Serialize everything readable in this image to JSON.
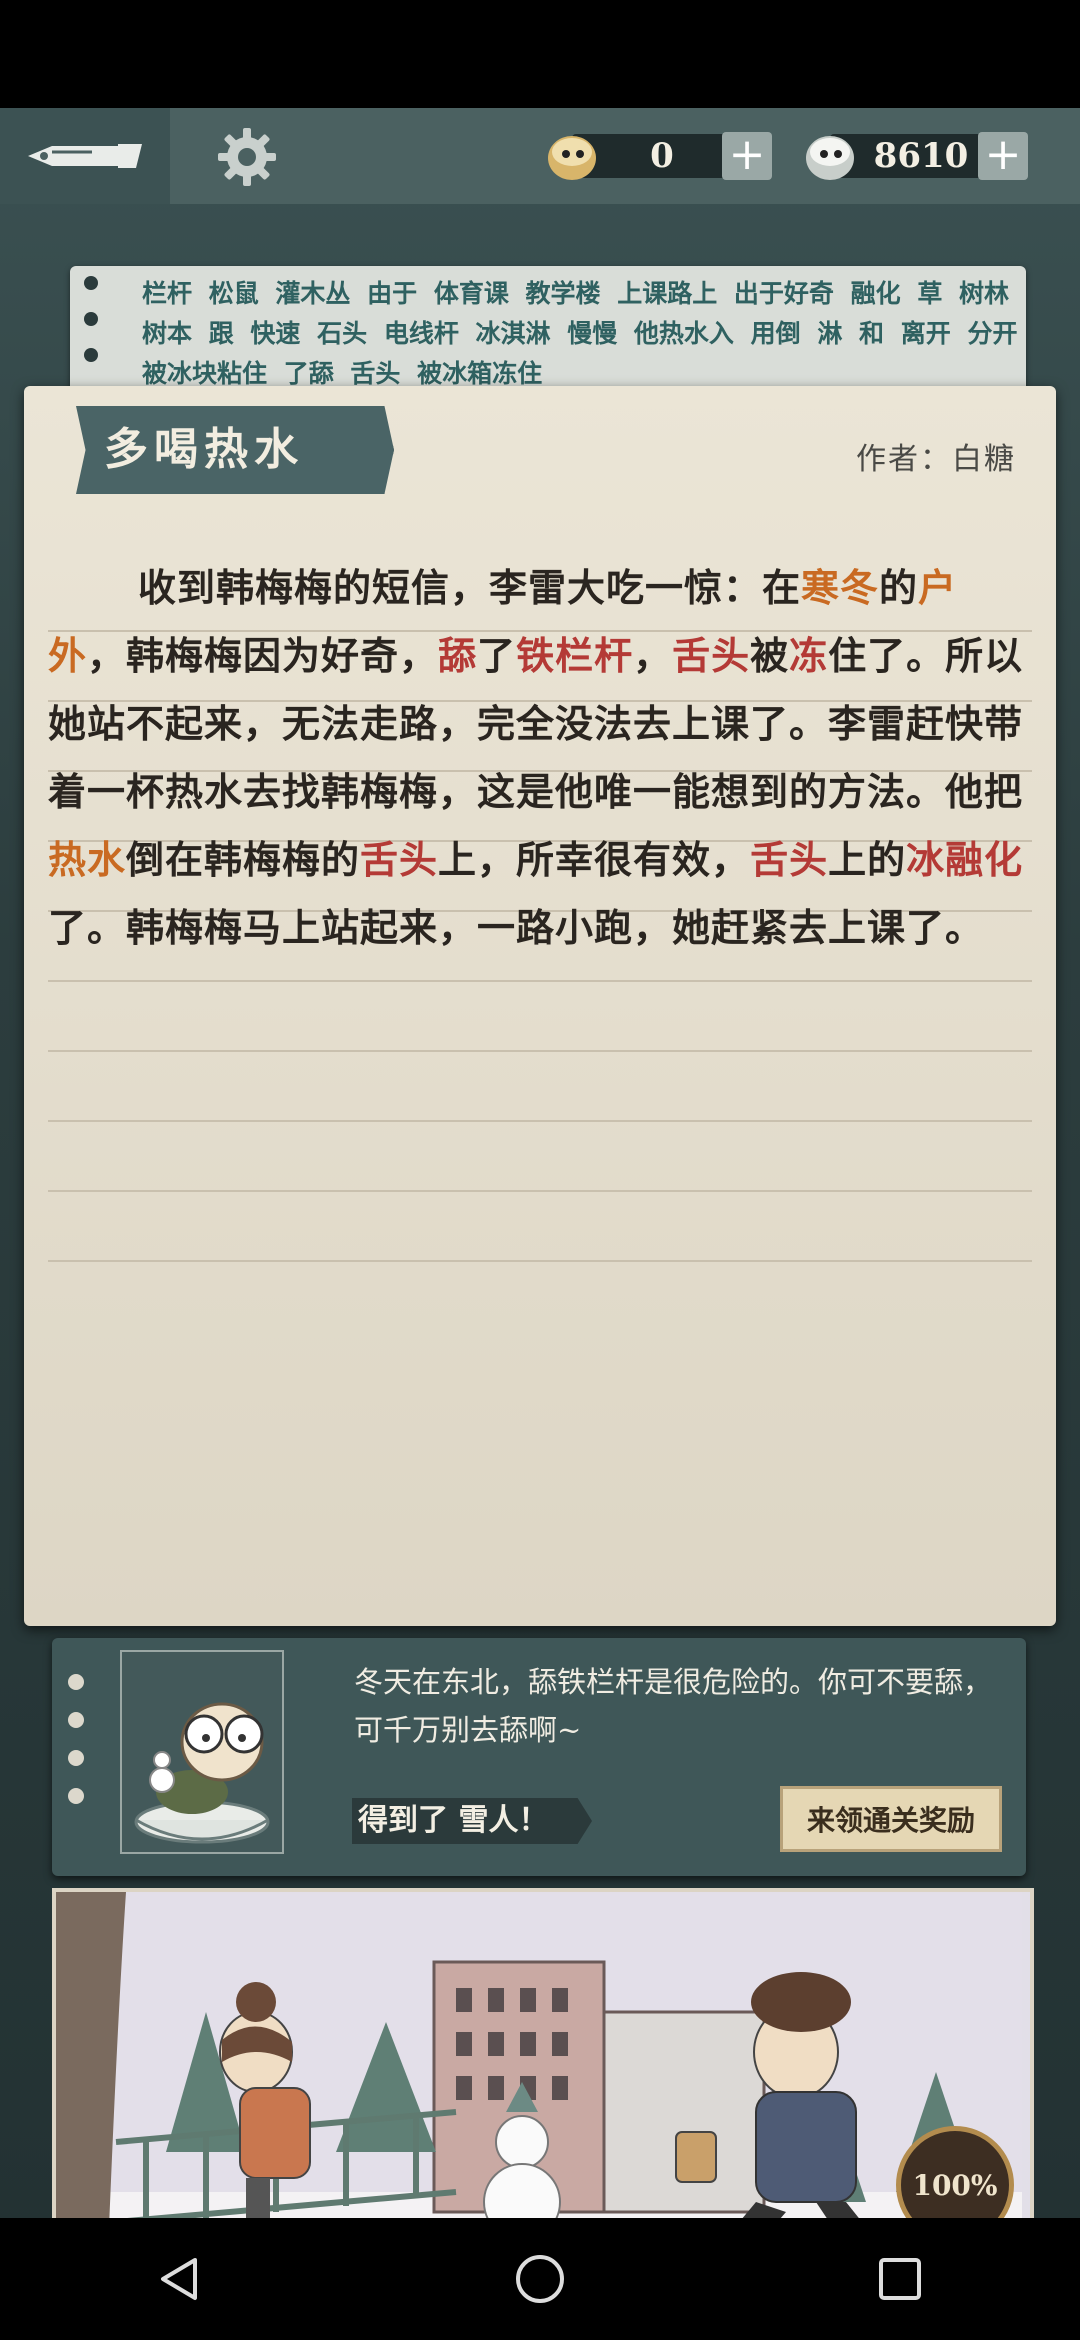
{
  "currency": [
    {
      "icon": "ghost-coin-icon",
      "value": "0"
    },
    {
      "icon": "ghost-gem-icon",
      "value": "8610"
    }
  ],
  "topbar": {
    "plus_label": "+"
  },
  "word_strip": {
    "text": "栏杆 松鼠 灌木丛 由于 体育课 教学楼 上课路上 出于好奇 融化 草 树林 树本 跟 快速 石头 电线杆 冰淇淋 慢慢 他热水入 用倒 淋 和 离开 分开 被冰块粘住 了舔 舌头 被冰箱冻住"
  },
  "story": {
    "title": "多喝热水",
    "author": "作者：白糖",
    "segments": [
      {
        "t": "收到韩梅梅的短信，李雷大吃一惊：在",
        "c": ""
      },
      {
        "t": "寒冬",
        "c": "warm"
      },
      {
        "t": "的",
        "c": ""
      },
      {
        "t": "户外",
        "c": "warm"
      },
      {
        "t": "，韩梅梅因为好奇，",
        "c": ""
      },
      {
        "t": "舔",
        "c": "red"
      },
      {
        "t": "了",
        "c": ""
      },
      {
        "t": "铁栏杆",
        "c": "red"
      },
      {
        "t": "，",
        "c": ""
      },
      {
        "t": "舌头",
        "c": "red"
      },
      {
        "t": "被",
        "c": ""
      },
      {
        "t": "冻",
        "c": "red"
      },
      {
        "t": "住了。所以她站不起来，无法走路，完全没法去上课了。李雷赶快带着一杯热水去找韩梅梅，这是他唯一能想到的方法。他把",
        "c": ""
      },
      {
        "t": "热水",
        "c": "warm"
      },
      {
        "t": "倒在韩梅梅的",
        "c": ""
      },
      {
        "t": "舌头",
        "c": "red"
      },
      {
        "t": "上，所幸很有效，",
        "c": ""
      },
      {
        "t": "舌头",
        "c": "red"
      },
      {
        "t": "上的",
        "c": ""
      },
      {
        "t": "冰融化",
        "c": "red"
      },
      {
        "t": "了。韩梅梅马上站起来，一路小跑，她赶紧去上课了。",
        "c": ""
      }
    ]
  },
  "hint": {
    "text": "冬天在东北，舔铁栏杆是很危险的。你可不要舔，可千万别去舔啊~",
    "reward_prefix": "得到了",
    "reward_item": "雪人！",
    "claim_button": "来领通关奖励"
  },
  "progress": "100%",
  "colors": {
    "accent_warm": "#c96a22",
    "accent_red": "#b43a36",
    "panel": "#3f5758"
  }
}
